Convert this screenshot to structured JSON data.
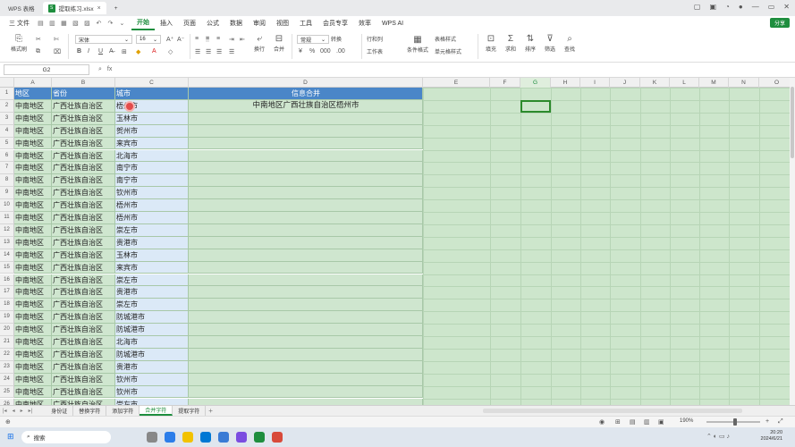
{
  "tabs": {
    "wps_label": "WPS 表格",
    "file_label": "提取练习.xlsx"
  },
  "menu": {
    "file": "三 文件",
    "items": [
      "开始",
      "插入",
      "页面",
      "公式",
      "数据",
      "审阅",
      "视图",
      "工具",
      "会员专享",
      "效率",
      "WPS AI"
    ],
    "share": "分享"
  },
  "ribbon": {
    "paste": "格式刷",
    "font_name": "宋体",
    "font_size": "16",
    "number_format": "常规",
    "convert": "转换",
    "wrap": "换行",
    "merge": "合并",
    "row_col": "行和列",
    "worksheet": "工作表",
    "cond_format": "条件格式",
    "cell_style": "单元格样式",
    "table_style": "表格样式",
    "fill": "填充",
    "sum": "求和",
    "sort": "排序",
    "filter": "筛选",
    "find": "查找"
  },
  "formula": {
    "cell_ref": "G2",
    "fx": "fx"
  },
  "columns": [
    "A",
    "B",
    "C",
    "D",
    "E",
    "F",
    "G",
    "H",
    "I",
    "J",
    "K",
    "L",
    "M",
    "N",
    "O"
  ],
  "header_row": {
    "a": "地区",
    "b": "省份",
    "c": "城市",
    "d": "信息合并"
  },
  "merged_text": "中南地区广西壮族自治区梧州市",
  "rows": [
    {
      "a": "中南地区",
      "b": "广西壮族自治区",
      "c": "梧州市"
    },
    {
      "a": "中南地区",
      "b": "广西壮族自治区",
      "c": "玉林市"
    },
    {
      "a": "中南地区",
      "b": "广西壮族自治区",
      "c": "贺州市"
    },
    {
      "a": "中南地区",
      "b": "广西壮族自治区",
      "c": "来宾市"
    },
    {
      "a": "中南地区",
      "b": "广西壮族自治区",
      "c": "北海市"
    },
    {
      "a": "中南地区",
      "b": "广西壮族自治区",
      "c": "南宁市"
    },
    {
      "a": "中南地区",
      "b": "广西壮族自治区",
      "c": "南宁市"
    },
    {
      "a": "中南地区",
      "b": "广西壮族自治区",
      "c": "钦州市"
    },
    {
      "a": "中南地区",
      "b": "广西壮族自治区",
      "c": "梧州市"
    },
    {
      "a": "中南地区",
      "b": "广西壮族自治区",
      "c": "梧州市"
    },
    {
      "a": "中南地区",
      "b": "广西壮族自治区",
      "c": "崇左市"
    },
    {
      "a": "中南地区",
      "b": "广西壮族自治区",
      "c": "贵港市"
    },
    {
      "a": "中南地区",
      "b": "广西壮族自治区",
      "c": "玉林市"
    },
    {
      "a": "中南地区",
      "b": "广西壮族自治区",
      "c": "来宾市"
    },
    {
      "a": "中南地区",
      "b": "广西壮族自治区",
      "c": "崇左市"
    },
    {
      "a": "中南地区",
      "b": "广西壮族自治区",
      "c": "贵港市"
    },
    {
      "a": "中南地区",
      "b": "广西壮族自治区",
      "c": "崇左市"
    },
    {
      "a": "中南地区",
      "b": "广西壮族自治区",
      "c": "防城港市"
    },
    {
      "a": "中南地区",
      "b": "广西壮族自治区",
      "c": "防城港市"
    },
    {
      "a": "中南地区",
      "b": "广西壮族自治区",
      "c": "北海市"
    },
    {
      "a": "中南地区",
      "b": "广西壮族自治区",
      "c": "防城港市"
    },
    {
      "a": "中南地区",
      "b": "广西壮族自治区",
      "c": "贵港市"
    },
    {
      "a": "中南地区",
      "b": "广西壮族自治区",
      "c": "钦州市"
    },
    {
      "a": "中南地区",
      "b": "广西壮族自治区",
      "c": "钦州市"
    },
    {
      "a": "中南地区",
      "b": "广西壮族自治区",
      "c": "崇左市"
    },
    {
      "a": "中南地区",
      "b": "广西壮族自治区",
      "c": ""
    }
  ],
  "sheet_tabs": [
    "身份证",
    "替换字符",
    "添加字符",
    "合并字符",
    "提取字符"
  ],
  "active_sheet": "合并字符",
  "zoom": "190%",
  "taskbar": {
    "search": "搜索",
    "time": "20:20",
    "date": "2024/6/21"
  }
}
